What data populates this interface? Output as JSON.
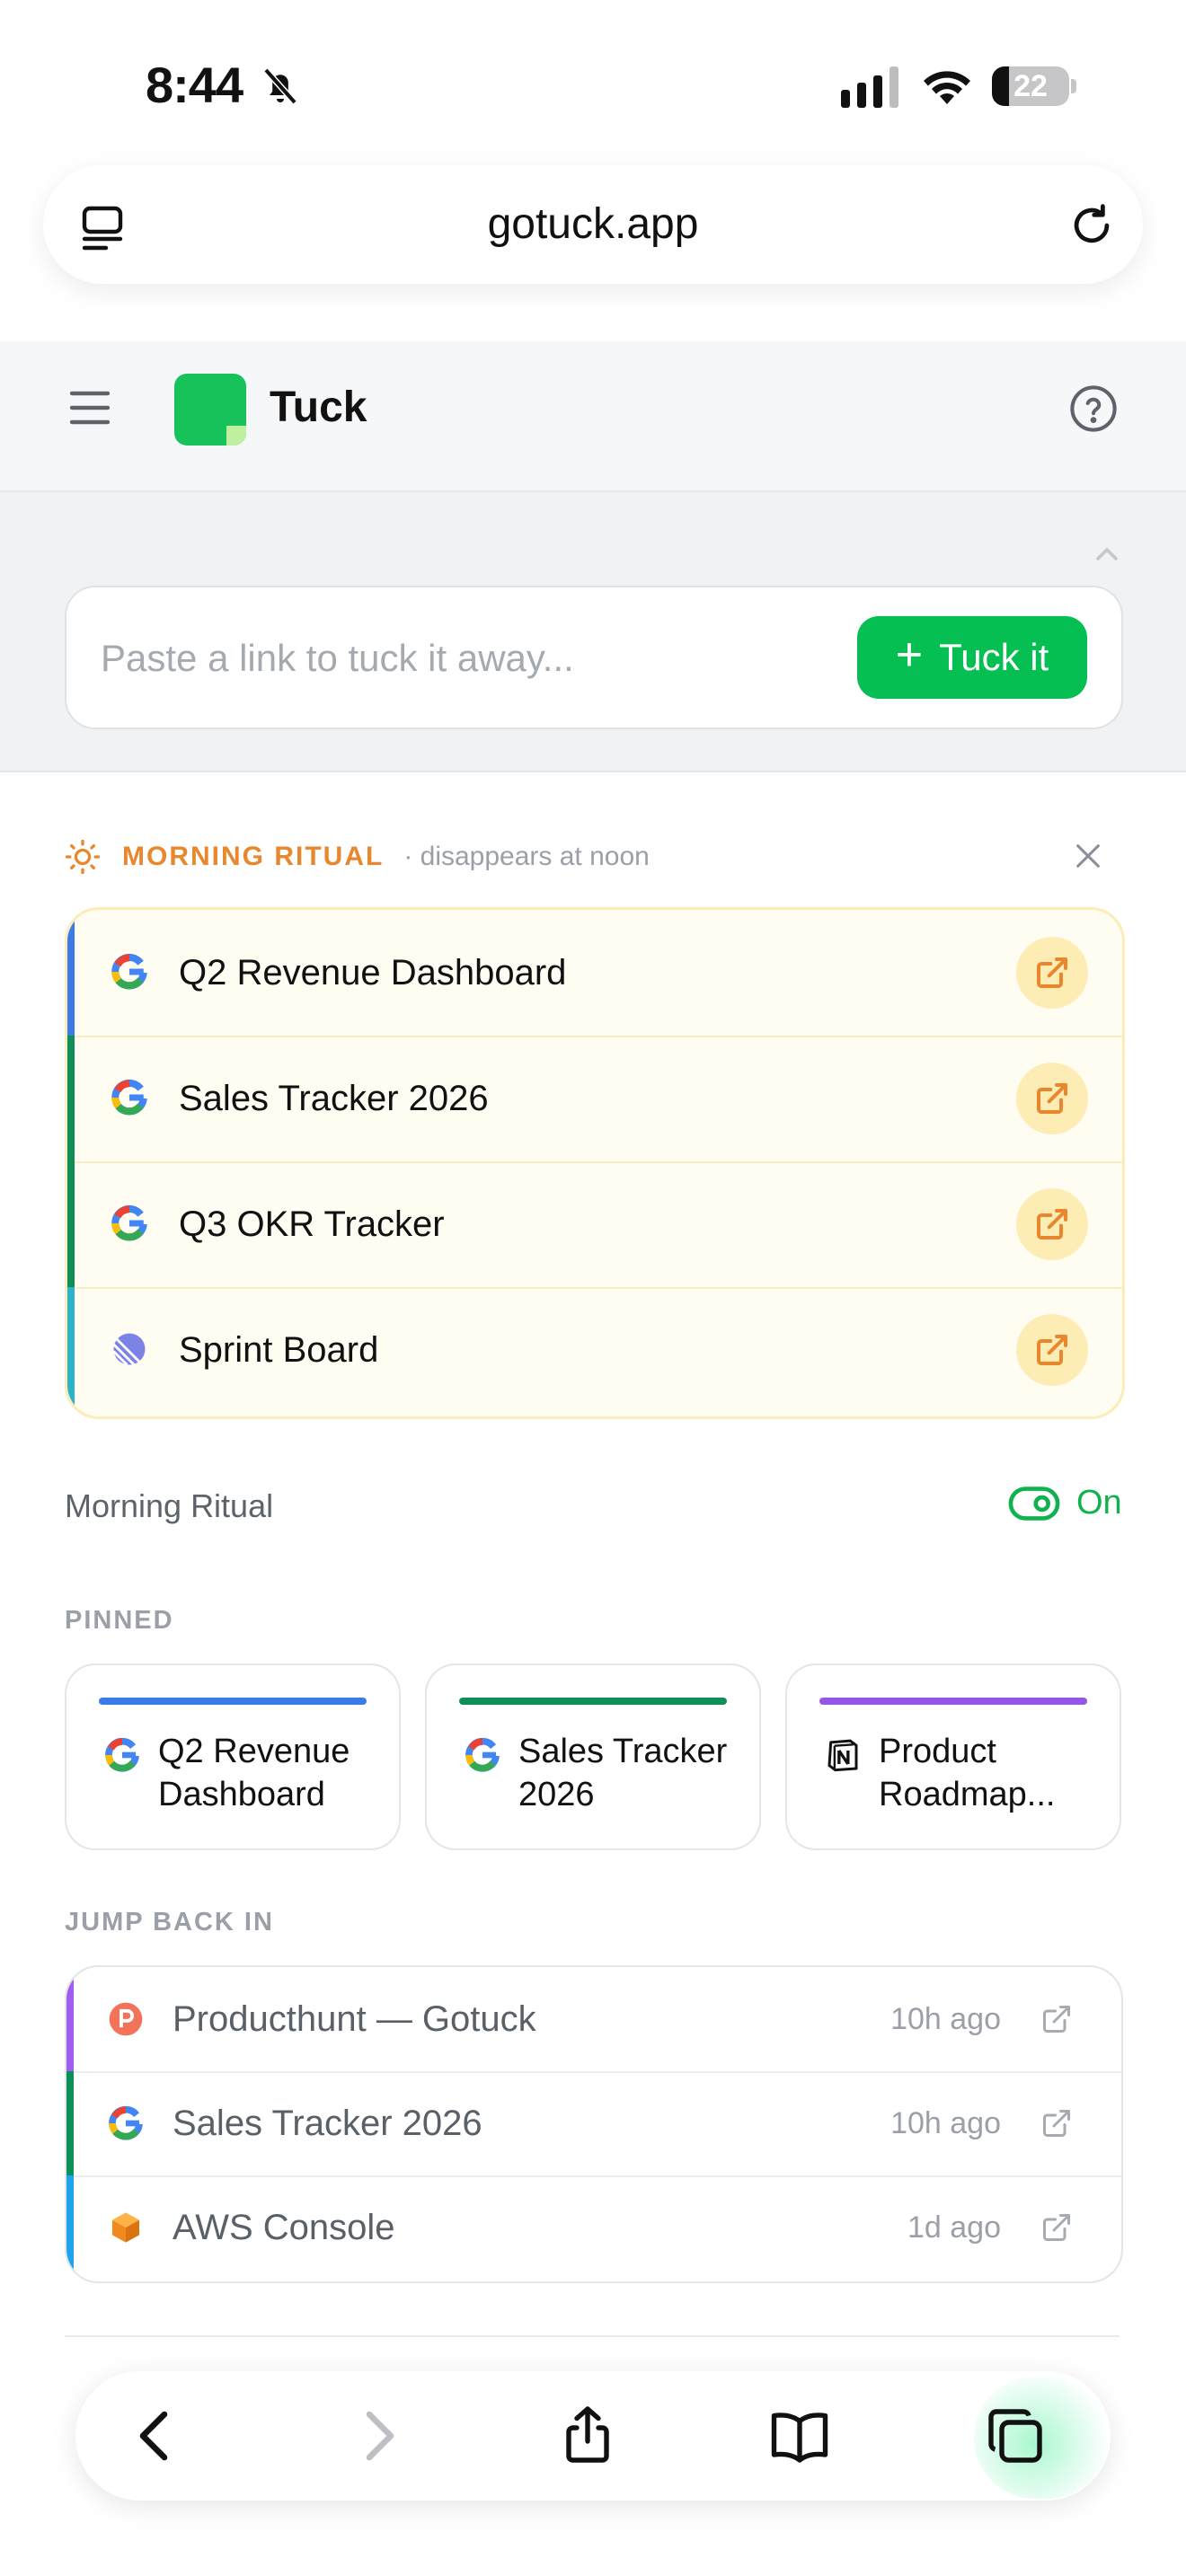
{
  "status_bar": {
    "time": "8:44",
    "battery": "22",
    "battery_level": 0.22
  },
  "browser": {
    "url": "gotuck.app"
  },
  "app": {
    "name": "Tuck"
  },
  "tuck_input": {
    "placeholder": "Paste a link to tuck it away...",
    "value": "",
    "button_label": "Tuck it"
  },
  "morning_ritual": {
    "title": "MORNING RITUAL",
    "subtitle": "· disappears at noon",
    "items": [
      {
        "label": "Q2 Revenue Dashboard",
        "icon": "google-icon",
        "accent": "#3b7be8"
      },
      {
        "label": "Sales Tracker 2026",
        "icon": "google-icon",
        "accent": "#0f8f58"
      },
      {
        "label": "Q3 OKR Tracker",
        "icon": "google-icon",
        "accent": "#0f8f58"
      },
      {
        "label": "Sprint Board",
        "icon": "linear-icon",
        "accent": "#2bb3c9"
      }
    ],
    "toggle_label": "Morning Ritual",
    "toggle_state": "On"
  },
  "pinned": {
    "label": "PINNED",
    "items": [
      {
        "title": "Q2 Revenue Dashboard",
        "icon": "google-icon",
        "accent": "#3b7be8"
      },
      {
        "title": "Sales Tracker 2026",
        "icon": "google-icon",
        "accent": "#0f8f58"
      },
      {
        "title": "Product Roadmap...",
        "icon": "notion-icon",
        "accent": "#9456e6"
      }
    ]
  },
  "jump_back_in": {
    "label": "JUMP BACK IN",
    "items": [
      {
        "label": "Producthunt — Gotuck",
        "time": "10h ago",
        "icon": "producthunt-icon",
        "accent": "#a25cf0"
      },
      {
        "label": "Sales Tracker 2026",
        "time": "10h ago",
        "icon": "google-icon",
        "accent": "#0f8f58"
      },
      {
        "label": "AWS Console",
        "time": "1d ago",
        "icon": "aws-cube-icon",
        "accent": "#1fa3ea"
      }
    ]
  },
  "colors": {
    "brand_green": "#05bf52",
    "ritual_orange": "#e8872d"
  }
}
